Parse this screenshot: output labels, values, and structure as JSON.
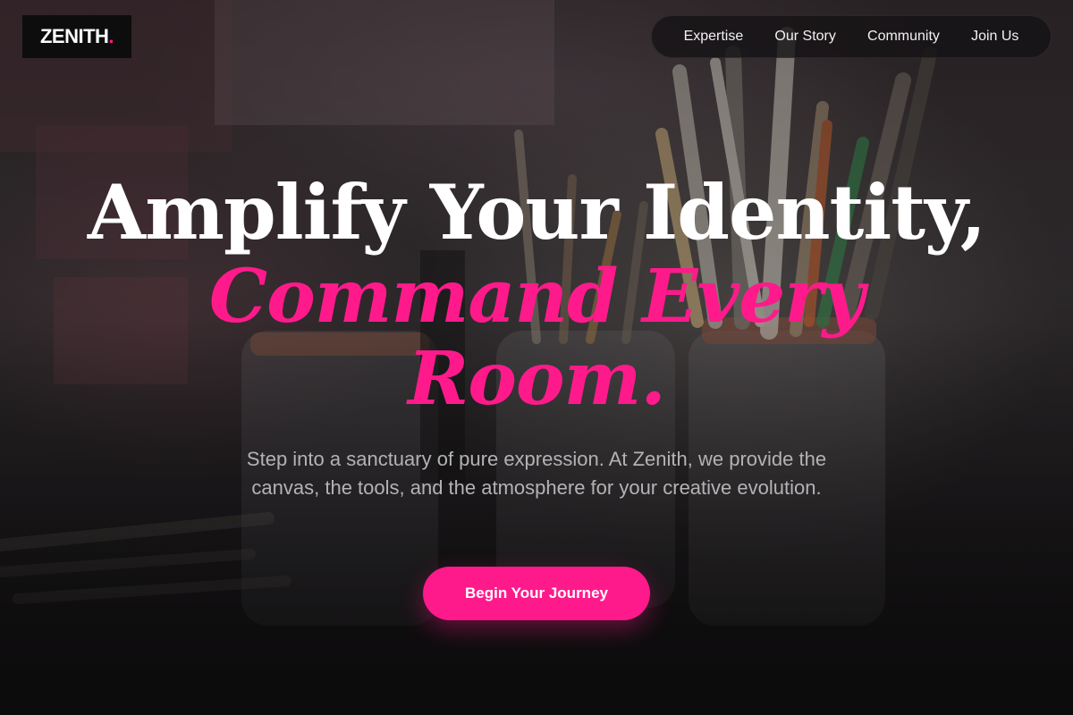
{
  "brand": {
    "name": "ZENITH",
    "dot": "."
  },
  "nav": {
    "items": [
      {
        "label": "Expertise"
      },
      {
        "label": "Our Story"
      },
      {
        "label": "Community"
      },
      {
        "label": "Join Us"
      }
    ]
  },
  "hero": {
    "headline_line1": "Amplify Your Identity,",
    "headline_line2": "Command Every",
    "headline_line3": "Room.",
    "subtitle": "Step into a sanctuary of pure expression. At Zenith, we provide the canvas, the tools, and the atmosphere for your creative evolution.",
    "cta_label": "Begin Your Journey",
    "background_image": "paint-brushes-in-jars-photo"
  },
  "colors": {
    "accent": "#ff1a8c",
    "background": "#151315",
    "text": "#ffffff",
    "muted_text": "#b5b2b5"
  }
}
